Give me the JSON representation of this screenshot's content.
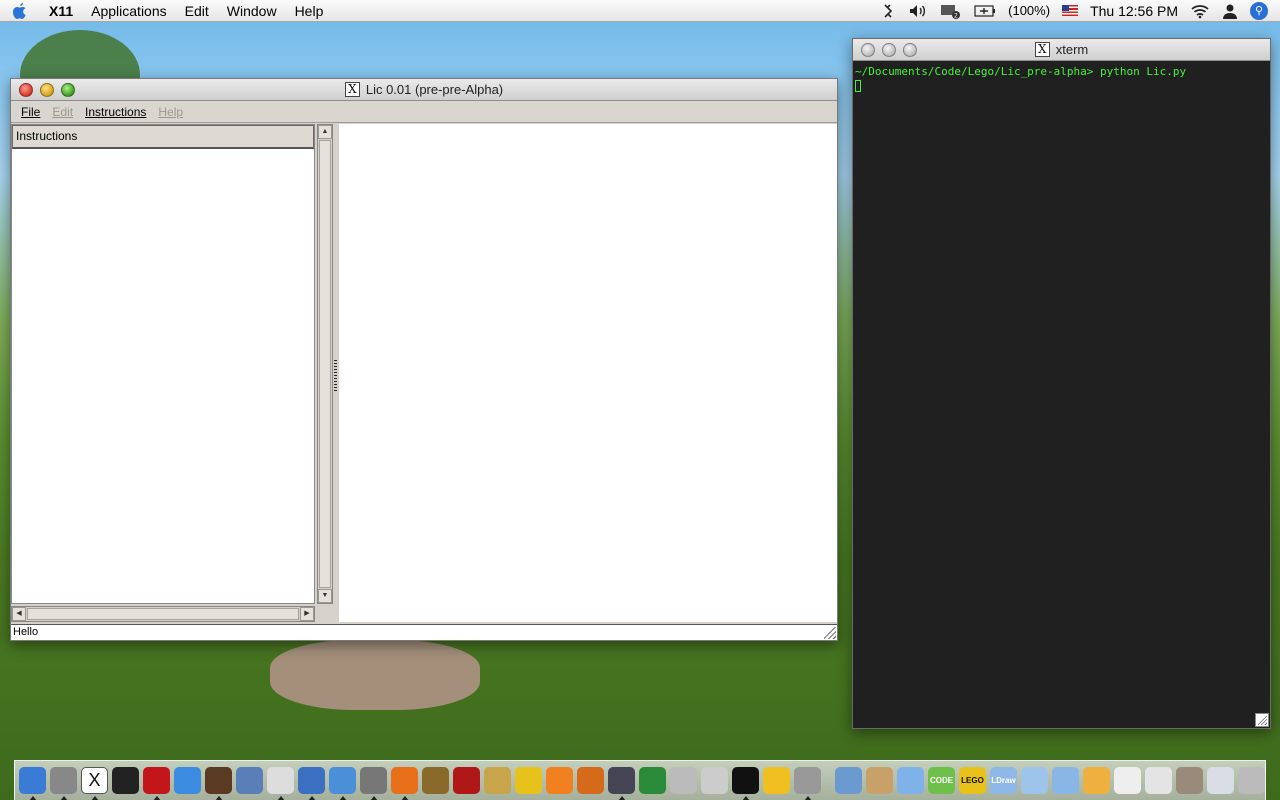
{
  "menubar": {
    "app_name": "X11",
    "items": [
      "Applications",
      "Edit",
      "Window",
      "Help"
    ],
    "battery": "(100%)",
    "clock": "Thu 12:56 PM"
  },
  "lic_window": {
    "title": "Lic 0.01 (pre-pre-Alpha)",
    "menu": [
      "File",
      "Edit",
      "Instructions",
      "Help"
    ],
    "tree_header": "Instructions",
    "status": "Hello"
  },
  "xterm": {
    "title": "xterm",
    "prompt": "~/Documents/Code/Lego/Lic_pre-alpha> python Lic.py"
  },
  "dock": {
    "apps": [
      {
        "name": "finder-icon",
        "color": "#3a7bd5",
        "label": "",
        "running": true
      },
      {
        "name": "dashboard-icon",
        "color": "#888",
        "label": "",
        "running": true
      },
      {
        "name": "x11-icon",
        "color": "#fff",
        "label": "X",
        "running": true
      },
      {
        "name": "terminal-icon",
        "color": "#222",
        "label": "",
        "running": false
      },
      {
        "name": "red-hat-icon",
        "color": "#c2161b",
        "label": "",
        "running": true
      },
      {
        "name": "itunes-icon",
        "color": "#3b8be0",
        "label": "",
        "running": false
      },
      {
        "name": "iphoto-icon",
        "color": "#5a3a22",
        "label": "",
        "running": true
      },
      {
        "name": "preview-icon",
        "color": "#5a7fb8",
        "label": "",
        "running": false
      },
      {
        "name": "textedit-icon",
        "color": "#ddd",
        "label": "",
        "running": true
      },
      {
        "name": "quicksilver-icon",
        "color": "#3a6fc2",
        "label": "",
        "running": true
      },
      {
        "name": "safari-icon",
        "color": "#4a8fd8",
        "label": "",
        "running": true
      },
      {
        "name": "tools-icon",
        "color": "#777",
        "label": "",
        "running": true
      },
      {
        "name": "firefox-icon",
        "color": "#e8701a",
        "label": "",
        "running": true
      },
      {
        "name": "acorn-icon",
        "color": "#8a6a2a",
        "label": "",
        "running": false
      },
      {
        "name": "photobooth-icon",
        "color": "#b01818",
        "label": "",
        "running": false
      },
      {
        "name": "book-icon",
        "color": "#c8a44a",
        "label": "",
        "running": false
      },
      {
        "name": "ldview-icon",
        "color": "#e6c21a",
        "label": "",
        "running": false
      },
      {
        "name": "scratch-icon",
        "color": "#f08020",
        "label": "",
        "running": false
      },
      {
        "name": "slide-icon",
        "color": "#d46a1a",
        "label": "",
        "running": false
      },
      {
        "name": "pen-icon",
        "color": "#445",
        "label": "",
        "running": true
      },
      {
        "name": "chart-icon",
        "color": "#2a8a3a",
        "label": "",
        "running": false
      },
      {
        "name": "glasses-icon",
        "color": "#bbb",
        "label": "",
        "running": false
      },
      {
        "name": "paper-icon",
        "color": "#ccc",
        "label": "",
        "running": false
      },
      {
        "name": "cow-icon",
        "color": "#111",
        "label": "",
        "running": true
      },
      {
        "name": "duck-icon",
        "color": "#f0c020",
        "label": "",
        "running": false
      },
      {
        "name": "utility-icon",
        "color": "#999",
        "label": "",
        "running": true
      }
    ],
    "stacks": [
      {
        "name": "applications-folder-icon",
        "color": "#6a9ad0",
        "label": ""
      },
      {
        "name": "home-icon",
        "color": "#c8a06a",
        "label": ""
      },
      {
        "name": "folder-icon",
        "color": "#7fb2e8",
        "label": ""
      },
      {
        "name": "code-folder-icon",
        "color": "#6fc04a",
        "label": "CODE"
      },
      {
        "name": "lego-folder-icon",
        "color": "#e8c21a",
        "label": "LEGO"
      },
      {
        "name": "ldraw-folder-icon",
        "color": "#8fb8e8",
        "label": "LDraw"
      },
      {
        "name": "docs-folder-icon",
        "color": "#9ec4ec",
        "label": ""
      },
      {
        "name": "q-folder-icon",
        "color": "#8ab6e6",
        "label": ""
      },
      {
        "name": "downloads-icon",
        "color": "#f0b040",
        "label": ""
      },
      {
        "name": "mail-icon",
        "color": "#eee",
        "label": ""
      },
      {
        "name": "letter-icon",
        "color": "#e4e4e4",
        "label": ""
      },
      {
        "name": "drive-icon",
        "color": "#9a8a7a",
        "label": ""
      },
      {
        "name": "documents-icon",
        "color": "#d8dde6",
        "label": ""
      },
      {
        "name": "trash-icon",
        "color": "#bbb",
        "label": ""
      }
    ]
  }
}
